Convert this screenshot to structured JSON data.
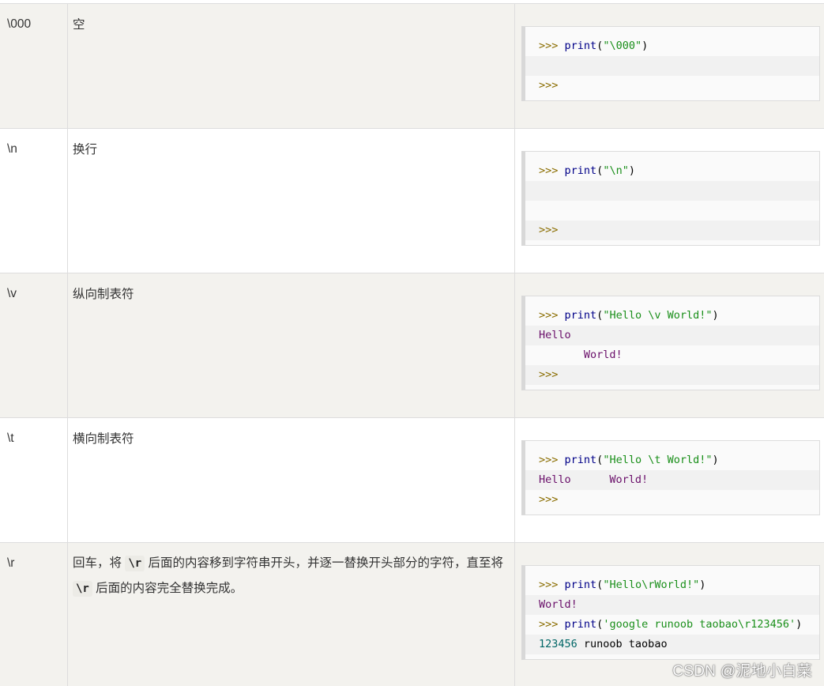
{
  "rows": [
    {
      "esc": "\\000",
      "desc": "空",
      "code": [
        {
          "prompt": ">>>",
          "fn": "print",
          "open": "(",
          "arg": "\"\\000\"",
          "close": ")"
        },
        {
          "blank": true
        },
        {
          "prompt": ">>>"
        }
      ]
    },
    {
      "esc": "\\n",
      "desc": "换行",
      "code": [
        {
          "prompt": ">>>",
          "fn": "print",
          "open": "(",
          "arg": "\"\\n\"",
          "close": ")"
        },
        {
          "blank": true
        },
        {
          "blank": true
        },
        {
          "prompt": ">>>"
        }
      ]
    },
    {
      "esc": "\\v",
      "desc": "纵向制表符",
      "code": [
        {
          "prompt": ">>>",
          "fn": "print",
          "open": "(",
          "arg": "\"Hello \\v World!\"",
          "close": ")"
        },
        {
          "output": "Hello"
        },
        {
          "output": "       World!"
        },
        {
          "prompt": ">>>"
        }
      ]
    },
    {
      "esc": "\\t",
      "desc": "横向制表符",
      "code": [
        {
          "prompt": ">>>",
          "fn": "print",
          "open": "(",
          "arg": "\"Hello \\t World!\"",
          "close": ")"
        },
        {
          "output": "Hello      World!"
        },
        {
          "prompt": ">>>"
        }
      ]
    },
    {
      "esc": "\\r",
      "desc_parts": [
        "回车，将 ",
        "\\r",
        " 后面的内容移到字符串开头，并逐一替换开头部分的字符，直至将 ",
        "\\r",
        " 后面的内容完全替换完成。"
      ],
      "code": [
        {
          "prompt": ">>>",
          "fn": "print",
          "open": "(",
          "arg": "\"Hello\\rWorld!\"",
          "close": ")"
        },
        {
          "output": "World!"
        },
        {
          "prompt": ">>>",
          "fn": "print",
          "open": "(",
          "arg": "'google runoob taobao\\r123456'",
          "close": ")"
        },
        {
          "num": "123456",
          "rest": " runoob taobao"
        }
      ]
    }
  ],
  "watermark": "CSDN @泥地小白菜"
}
